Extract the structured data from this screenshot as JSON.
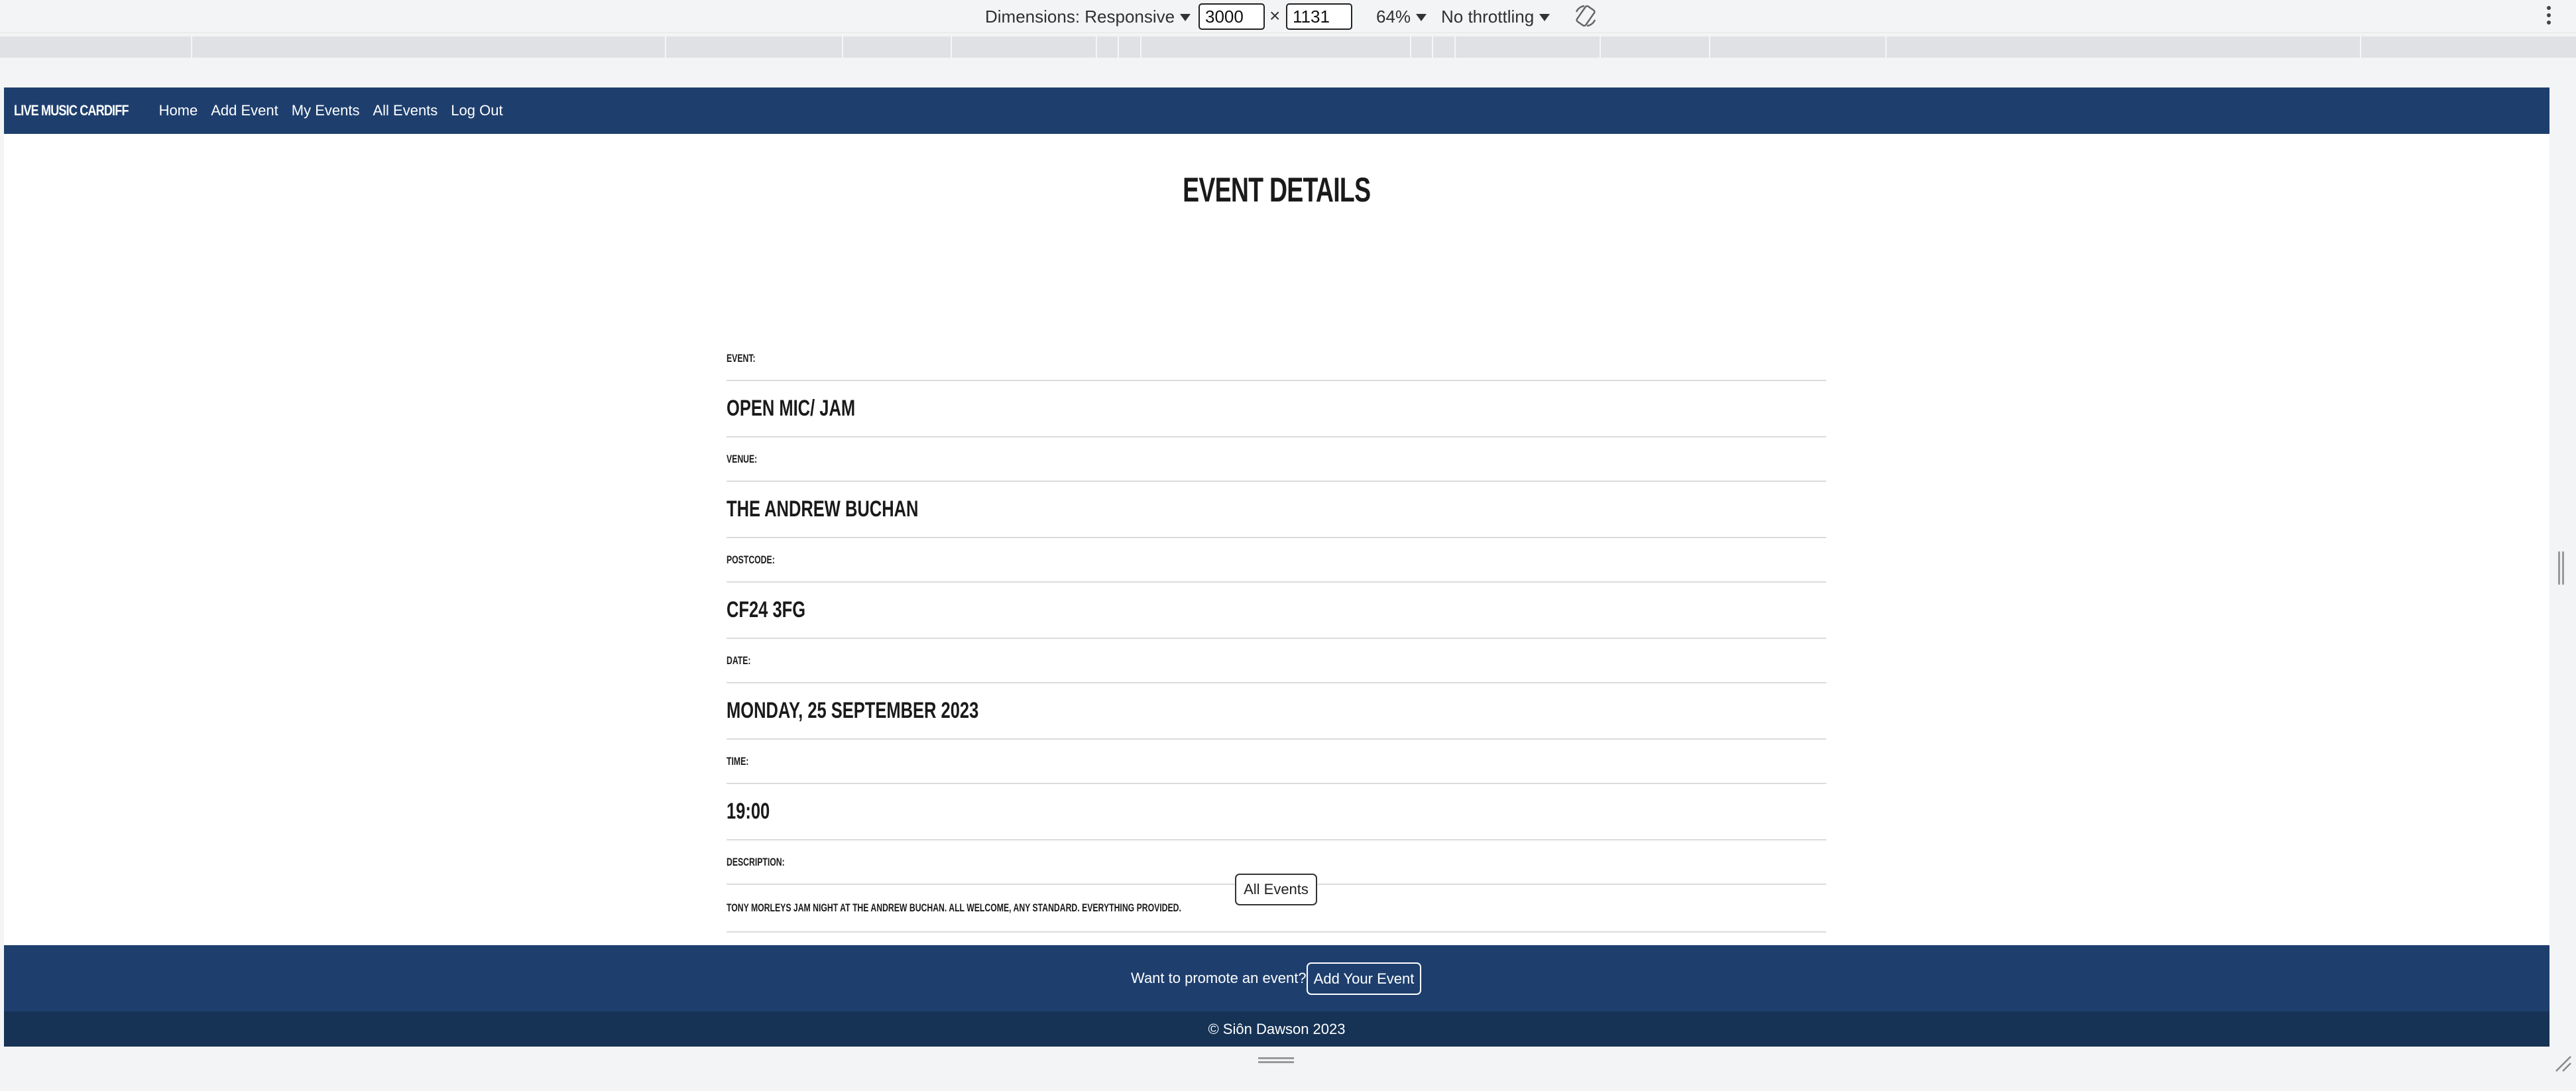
{
  "devtools": {
    "dimensions_label": "Dimensions: Responsive",
    "width_value": "3000",
    "times_symbol": "×",
    "height_value": "1131",
    "zoom_label": "64%",
    "throttling_label": "No throttling"
  },
  "nav": {
    "brand": "Live Music Cardiff",
    "links": [
      "Home",
      "Add Event",
      "My Events",
      "All Events",
      "Log Out"
    ]
  },
  "page": {
    "title": "Event Details"
  },
  "details": {
    "event_label": "Event:",
    "event_value": "Open Mic/ Jam",
    "venue_label": "Venue:",
    "venue_value": "The Andrew Buchan",
    "postcode_label": "Postcode:",
    "postcode_value": "CF24 3FG",
    "date_label": "Date:",
    "date_value": "Monday, 25 September 2023",
    "time_label": "Time:",
    "time_value": "19:00",
    "description_label": "Description:",
    "description_value": "Tony Morleys Jam Night at the Andrew Buchan. All welcome, any standard. Everything provided."
  },
  "all_events_button": "All Events",
  "footer": {
    "promo_text": "Want to promote an event?",
    "add_event_button": "Add Your Event",
    "copyright": "© Siôn Dawson 2023"
  },
  "colors": {
    "nav_background": "#1e3f6e",
    "copyright_background": "#163355"
  }
}
